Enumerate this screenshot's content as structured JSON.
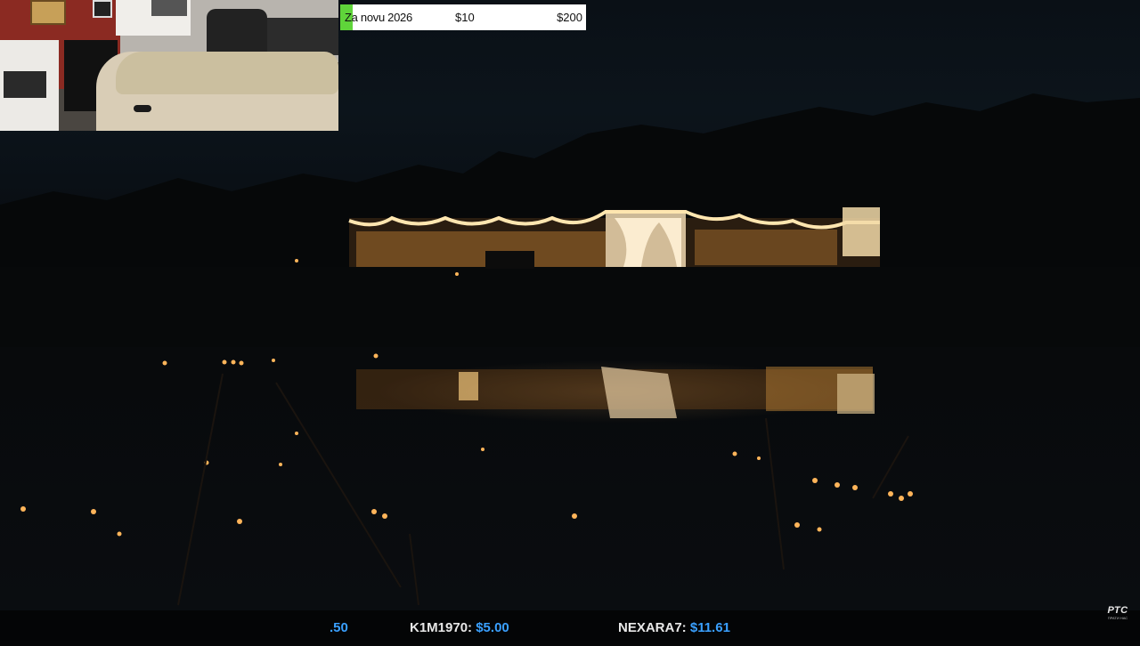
{
  "goal": {
    "title": "Za novu 2026",
    "min_label": "$10",
    "max_label": "$200",
    "progress_fraction": 0.05,
    "fill_color": "#5fd43a"
  },
  "ticker": {
    "items": [
      {
        "name": "",
        "amount": ".50"
      },
      {
        "name": "K1M1970:",
        "amount": "$5.00"
      },
      {
        "name": "NEXARA7:",
        "amount": "$11.61"
      }
    ],
    "amount_color": "#3aa0ff"
  },
  "logo": {
    "mark": "РТС",
    "sub": "ПРАТИ НАС"
  },
  "scene": {
    "description_icon": "video-frame"
  }
}
